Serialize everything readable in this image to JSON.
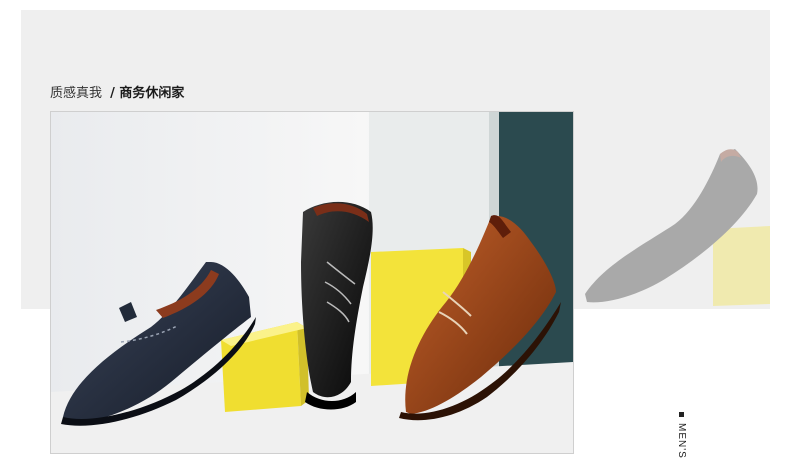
{
  "banner": {
    "heading": "质感真我",
    "subheading": "/ 商务休闲家",
    "side_tag": "MEN'S"
  },
  "colors": {
    "band": "#efefef",
    "yellow": "#f3e33a",
    "teal": "#2b4a4f",
    "navy_shoe": "#1f2737",
    "black_shoe": "#121212",
    "brown_shoe": "#9a4313"
  },
  "images": {
    "main_photo": "three-leather-derby-shoes-on-yellow-cubes",
    "ghost_photo": "faded-single-shoe-on-yellow-cube"
  }
}
